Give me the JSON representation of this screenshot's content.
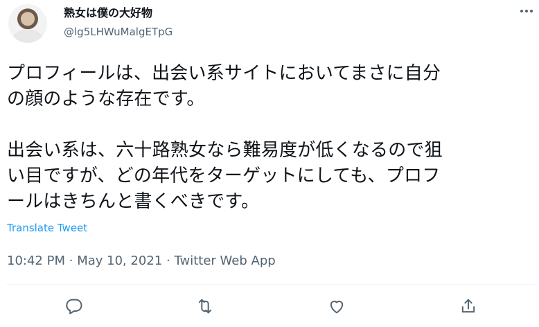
{
  "author": {
    "name": "熟女は僕の大好物",
    "handle": "@lg5LHWuMalgETpG"
  },
  "tweet": {
    "text": "プロフィールは、出会い系サイトにおいてまさに自分\nの顔のような存在です。\n\n出会い系は、六十路熟女なら難易度が低くなるので狙\nい目ですが、どの年代をターゲットにしても、プロフ\nールはきちんと書くべきです。",
    "translate_label": "Translate Tweet",
    "time": "10:42 PM",
    "separator1": "·",
    "date": "May 10, 2021",
    "separator2": "·",
    "source": "Twitter Web App"
  },
  "icons": {
    "more": "more-icon",
    "reply": "reply-icon",
    "retweet": "retweet-icon",
    "like": "like-icon",
    "share": "share-icon"
  },
  "colors": {
    "text": "#0f1419",
    "secondary": "#536471",
    "link": "#1d9bf0",
    "divider": "#eff3f4"
  }
}
